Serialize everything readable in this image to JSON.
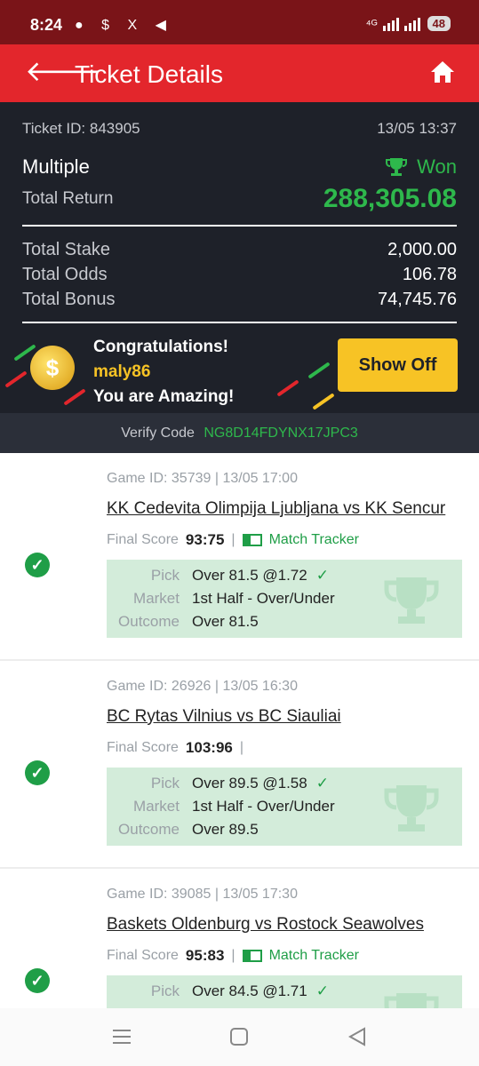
{
  "status": {
    "time": "8:24",
    "left_icons": "● $ X ◀",
    "network": "⁴ᴳ",
    "battery": "48"
  },
  "header": {
    "title": "Ticket Details"
  },
  "ticket": {
    "id_text": "Ticket ID: 843905",
    "datetime": "13/05 13:37",
    "bet_type": "Multiple",
    "status": "Won",
    "total_return_label": "Total Return",
    "total_return": "288,305.08",
    "stake_label": "Total Stake",
    "stake": "2,000.00",
    "odds_label": "Total Odds",
    "odds": "106.78",
    "bonus_label": "Total Bonus",
    "bonus": "74,745.76"
  },
  "congrats": {
    "line1": "Congratulations!",
    "username": "maly86",
    "line3": "You are Amazing!",
    "button": "Show Off"
  },
  "verify": {
    "label": "Verify Code",
    "code": "NG8D14FDYNX17JPC3"
  },
  "labels": {
    "final_score": "Final Score",
    "match_tracker": "Match Tracker",
    "pick": "Pick",
    "market": "Market",
    "outcome": "Outcome"
  },
  "games": [
    {
      "game_id": "Game ID: 35739 | 13/05 17:00",
      "match": "KK Cedevita Olimpija Ljubljana vs KK Sencur",
      "score": "93:75",
      "pick": "Over 81.5 @1.72",
      "market": "1st Half - Over/Under",
      "outcome": "Over 81.5"
    },
    {
      "game_id": "Game ID: 26926 | 13/05 16:30",
      "match": "BC Rytas Vilnius vs BC Siauliai",
      "score": "103:96",
      "pick": "Over 89.5 @1.58",
      "market": "1st Half - Over/Under",
      "outcome": "Over 89.5"
    },
    {
      "game_id": "Game ID: 39085 | 13/05 17:30",
      "match": "Baskets Oldenburg vs Rostock Seawolves",
      "score": "95:83",
      "pick": "Over 84.5 @1.71"
    }
  ],
  "colors": {
    "app_red": "#e3262c",
    "status_bar": "#7a1418",
    "dark_panel": "#1e2129",
    "win_green": "#2eb84c",
    "gold": "#f7c325",
    "pick_bg": "#d3ecda"
  },
  "icons": [
    "back-arrow-icon",
    "home-icon",
    "trophy-icon",
    "coin-icon",
    "check-circle-icon",
    "match-tracker-icon",
    "menu-icon",
    "home-square-icon",
    "back-triangle-icon"
  ]
}
